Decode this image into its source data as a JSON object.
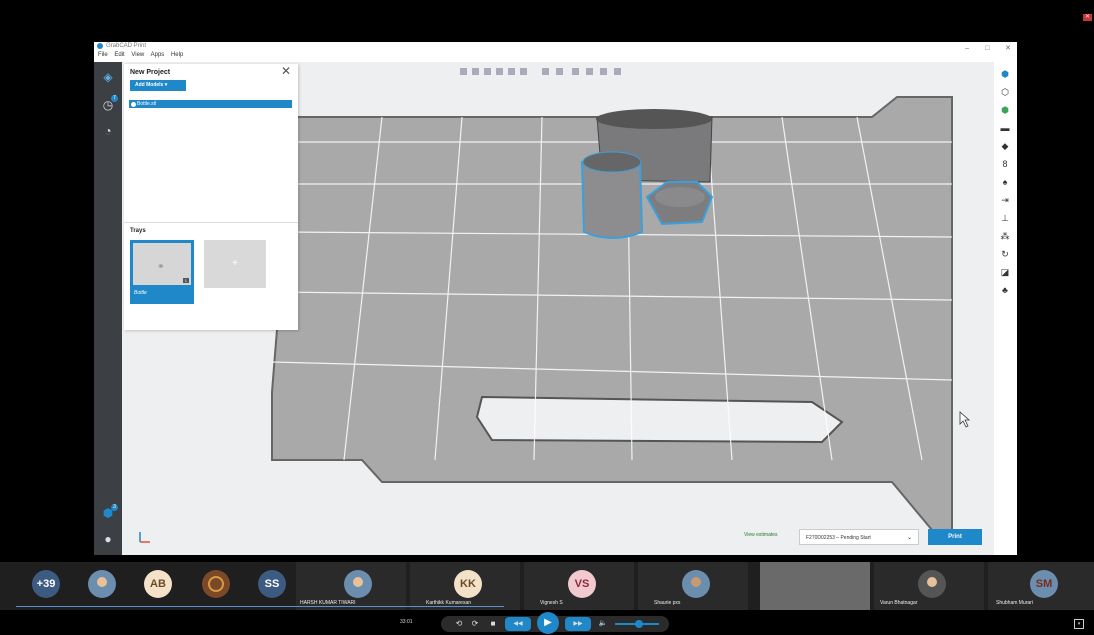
{
  "app": {
    "title": "GrabCAD Print",
    "menu": [
      "File",
      "Edit",
      "View",
      "Apps",
      "Help"
    ],
    "window_controls": [
      "–",
      "□",
      "✕"
    ]
  },
  "panel": {
    "title": "New Project",
    "close": "✕",
    "add_models": "Add Models  ▾",
    "model_item": "Bottle.stl",
    "trays_title": "Trays",
    "tray_name": "Bottle",
    "tray_badge": "1",
    "tray_add": "+"
  },
  "left_rail": {
    "badge": "7",
    "bottom_badge": "3"
  },
  "bottom": {
    "view_estimates": "View estimates",
    "job": "F270D02253 – Pending Start",
    "print": "Print"
  },
  "participants": [
    {
      "initials": "+39",
      "color": "#3d5a80",
      "type": "count"
    },
    {
      "initials": "",
      "color": "#6b8eae",
      "type": "photo"
    },
    {
      "initials": "AB",
      "color": "#f3e2c7",
      "type": "initials"
    },
    {
      "initials": "",
      "color": "#7a4a28",
      "type": "photo"
    },
    {
      "initials": "SS",
      "color": "#3d5a80",
      "type": "initials"
    },
    {
      "initials": "",
      "color": "#6b8eae",
      "type": "photo",
      "name": "HARSH KUMAR TIWARI"
    },
    {
      "initials": "KK",
      "color": "#f3e2c7",
      "type": "initials",
      "name": "Karthikk Kumaresan"
    },
    {
      "initials": "VS",
      "color": "#f2c9cf",
      "type": "initials",
      "name": "Vignesh S"
    },
    {
      "initials": "",
      "color": "#6b8eae",
      "type": "photo",
      "name": "Shaurie pxs"
    },
    {
      "initials": "",
      "color": "#555",
      "type": "video"
    },
    {
      "initials": "",
      "color": "#6b8eae",
      "type": "photo",
      "name": "Varun Bhatnagar"
    },
    {
      "initials": "SM",
      "color": "#f2a99a",
      "type": "initials",
      "name": "Shubham Murari"
    }
  ],
  "controls": {
    "timestamp": "33:01",
    "buttons": [
      "⟲",
      "⟳",
      "■",
      "◀◀",
      "▶",
      "▶▶",
      "🔈"
    ]
  }
}
